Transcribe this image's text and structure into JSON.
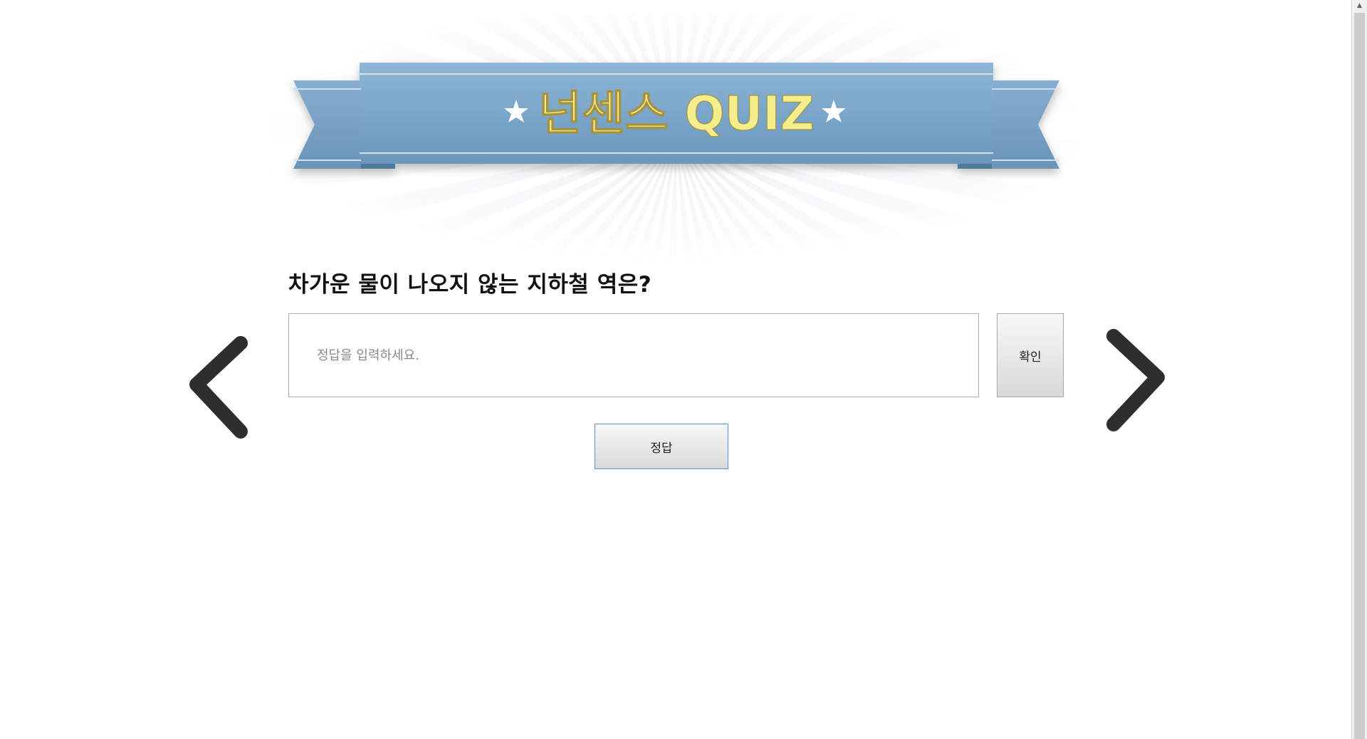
{
  "banner": {
    "title": "넌센스 QUIZ",
    "ribbon_color": "#7ba7c9",
    "text_color": "#f5ee8c"
  },
  "quiz": {
    "question": "차가운 물이 나오지 않는 지하철 역은?",
    "answer_placeholder": "정답을 입력하세요.",
    "answer_value": "",
    "confirm_label": "확인",
    "show_answer_label": "정답"
  },
  "navigation": {
    "prev_icon": "chevron-left-icon",
    "next_icon": "chevron-right-icon"
  }
}
